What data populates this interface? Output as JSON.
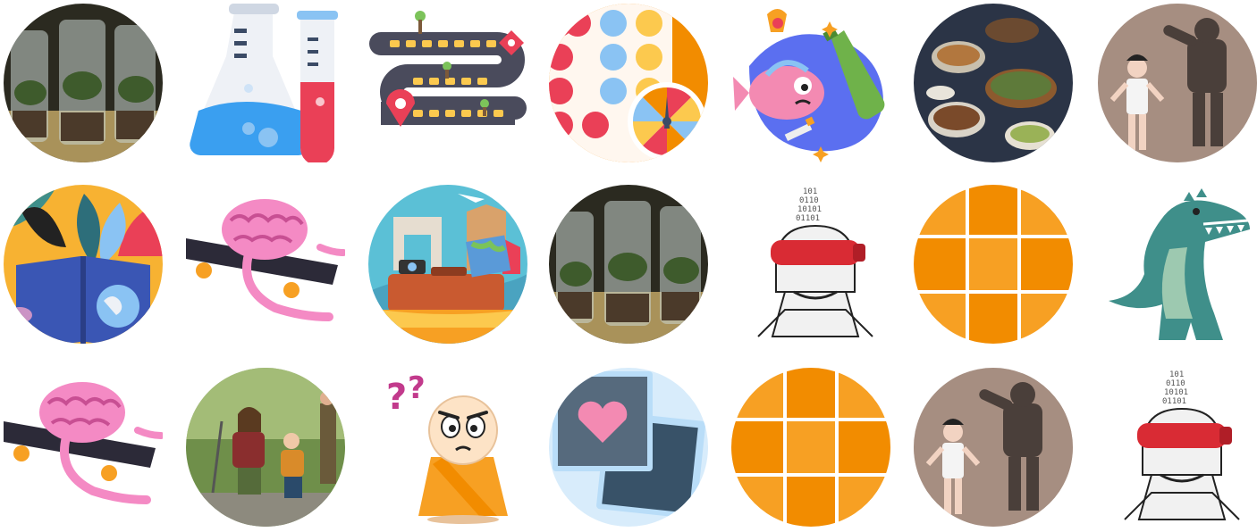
{
  "gallery": {
    "rows": [
      [
        "terrarium-jars-photo",
        "science-flasks-icon",
        "board-game-path-icon",
        "dots-and-spinner-icon",
        "fish-bottle-pollution-icon",
        "food-buffet-photo",
        "girl-and-robot-photo"
      ],
      [
        "open-book-jungle-icon",
        "brain-on-skateboard-icon",
        "travel-suitcase-landmarks-icon",
        "terrarium-jars-photo",
        "robot-binary-head-icon",
        "orange-grid-icon",
        "green-dinosaur-icon"
      ],
      [
        "brain-on-skateboard-icon",
        "hiking-family-photo",
        "confused-monk-icon",
        "heart-photo-cards-icon",
        "orange-grid-icon",
        "girl-and-robot-photo",
        "robot-binary-head-icon"
      ]
    ]
  },
  "colors": {
    "orange": "#f7a023",
    "orange_dark": "#f28c00",
    "red": "#ea4057",
    "blue": "#8ac3f3",
    "yellow": "#fcc94e",
    "teal": "#3f8f8a",
    "pink": "#f0a2c9",
    "navy": "#3b4b66"
  }
}
